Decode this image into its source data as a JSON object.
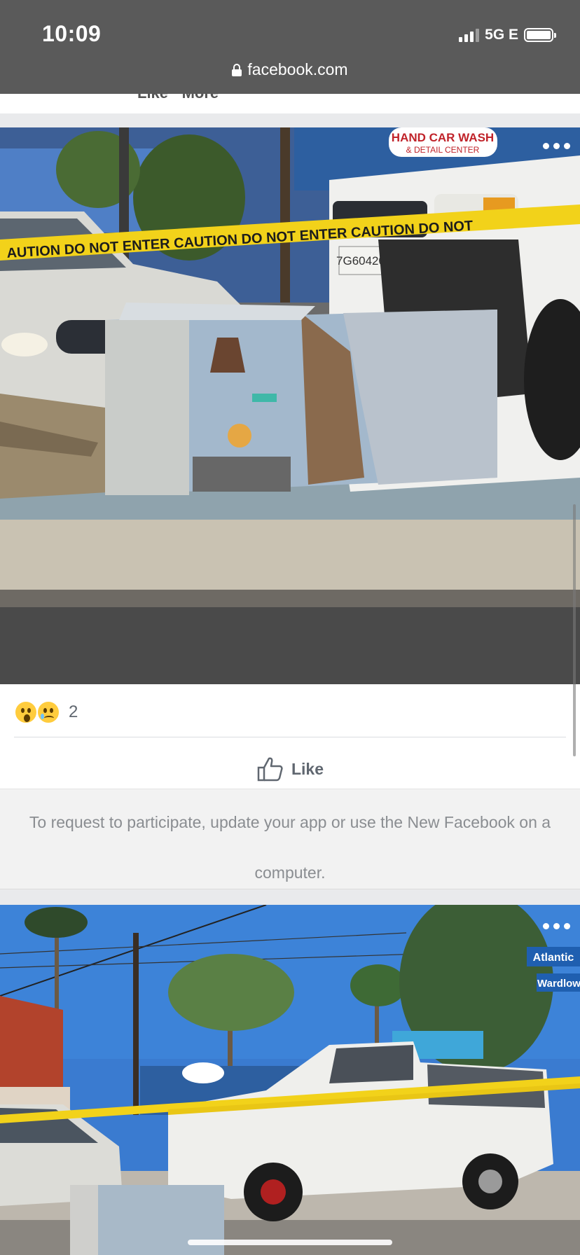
{
  "status_bar": {
    "time": "10:09",
    "network": "5G E",
    "signal_bars": 3,
    "battery_level": 0.95
  },
  "browser": {
    "url": "facebook.com"
  },
  "previous_post": {
    "partial_actions": "Like · More"
  },
  "post": {
    "photo": "photo of white pickup truck crashed into painted utility box behind caution tape",
    "reaction_count": "2",
    "reactions": [
      "wow-emoji",
      "sad-emoji"
    ],
    "like_label": "Like",
    "notice_line1": "To request to participate, update your app or use the New Facebook on a",
    "notice_line2": "computer."
  },
  "next_post": {
    "photo": "photo of white pickup truck on sidewalk at intersection with caution tape"
  },
  "colors": {
    "chrome_bg": "#5a5a5a",
    "caution_yellow": "#f2d21a",
    "truck_white": "#f0f0ee"
  }
}
